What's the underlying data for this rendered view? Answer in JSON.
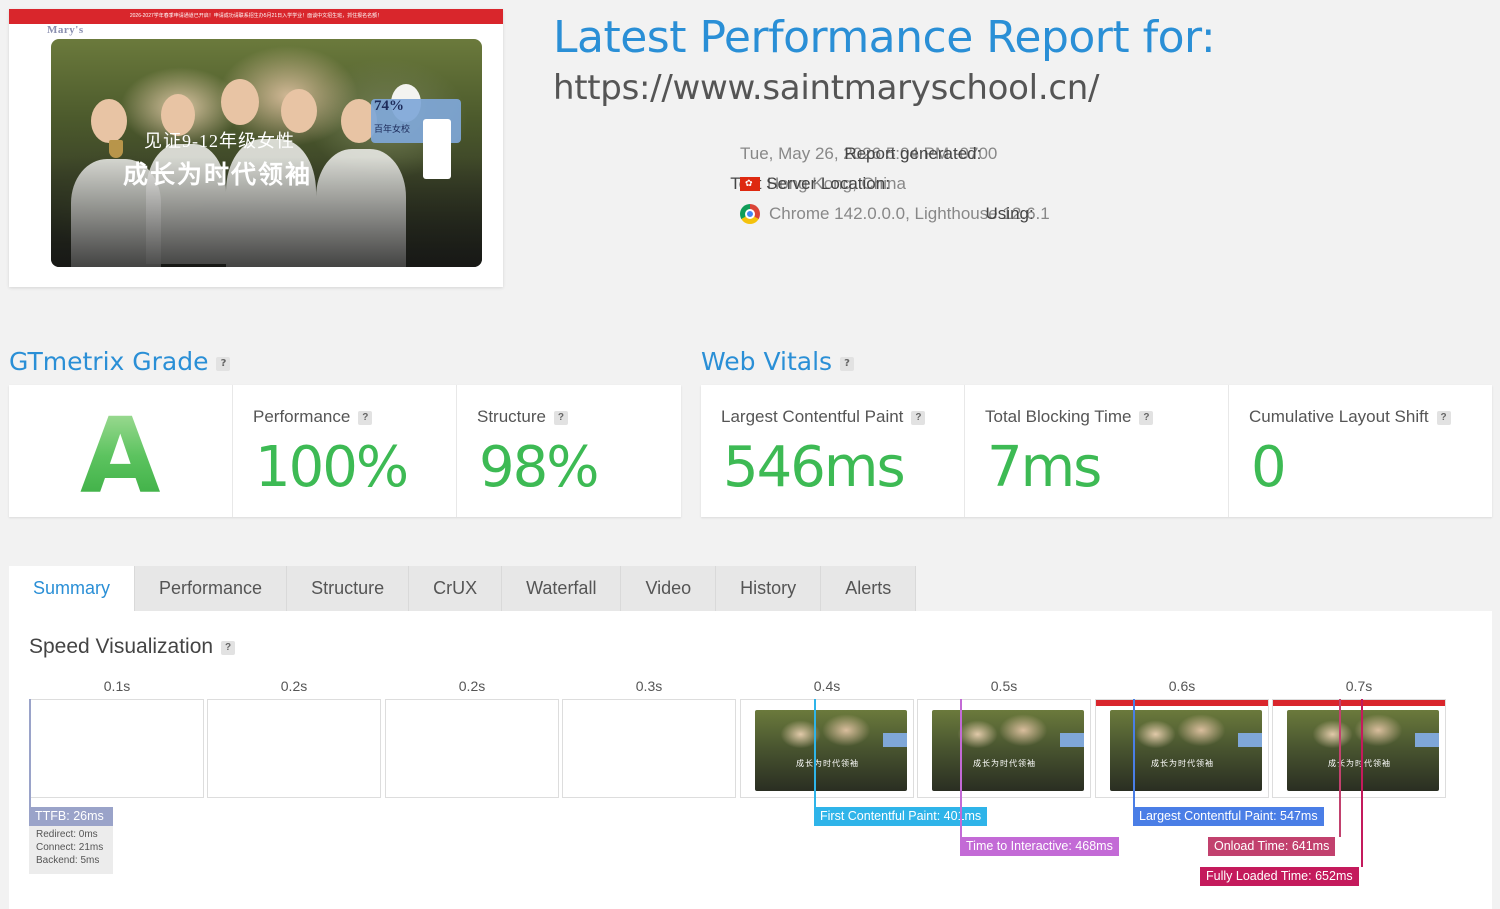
{
  "header": {
    "title": "Latest Performance Report for:",
    "url": "https://www.saintmaryschool.cn/",
    "meta": [
      {
        "label": "Report generated:",
        "value": "Tue, May 26, 2026 5:04 PM -0700"
      },
      {
        "label": "Test Server Location:",
        "value": "Hong Kong, China",
        "icon": "hong-kong-flag-icon"
      },
      {
        "label": "Using:",
        "value": "Chrome 142.0.0.0, Lighthouse 12.6.1",
        "icon": "chrome-icon"
      }
    ]
  },
  "thumbnail": {
    "topbar": "2026-2027学年春季申请通道已开启！申请成功请联系招生办5月21日入学学业！面谈中文招生班，抓住报名名额！",
    "logo": "Mary's",
    "hero_line1": "见证9-12年级女性",
    "hero_line2": "成长为时代领袖",
    "badge_pct": "74%",
    "badge_text": "百年女校"
  },
  "grade": {
    "title": "GTmetrix Grade",
    "letter": "A",
    "performance_label": "Performance",
    "performance_value": "100%",
    "structure_label": "Structure",
    "structure_value": "98%"
  },
  "vitals": {
    "title": "Web Vitals",
    "lcp_label": "Largest Contentful Paint",
    "lcp_value": "546ms",
    "tbt_label": "Total Blocking Time",
    "tbt_value": "7ms",
    "cls_label": "Cumulative Layout Shift",
    "cls_value": "0"
  },
  "tabs": [
    "Summary",
    "Performance",
    "Structure",
    "CrUX",
    "Waterfall",
    "Video",
    "History",
    "Alerts"
  ],
  "active_tab": "Summary",
  "speed": {
    "title": "Speed Visualization",
    "frames": [
      "0.1s",
      "0.2s",
      "0.2s",
      "0.3s",
      "0.4s",
      "0.5s",
      "0.6s",
      "0.7s"
    ],
    "ttfb": {
      "label": "TTFB: 26ms",
      "redirect": "Redirect: 0ms",
      "connect": "Connect: 21ms",
      "backend": "Backend: 5ms"
    },
    "markers": {
      "fcp": "First Contentful Paint: 401ms",
      "tti": "Time to Interactive: 468ms",
      "lcp": "Largest Contentful Paint: 547ms",
      "onload": "Onload Time: 641ms",
      "fully": "Fully Loaded Time: 652ms"
    },
    "colors": {
      "ttfb": "#9aa3c9",
      "fcp": "#2fb4e9",
      "tti": "#c36ad6",
      "lcp": "#4a7ee6",
      "onload": "#c2416e",
      "fully": "#c41a5c"
    }
  }
}
